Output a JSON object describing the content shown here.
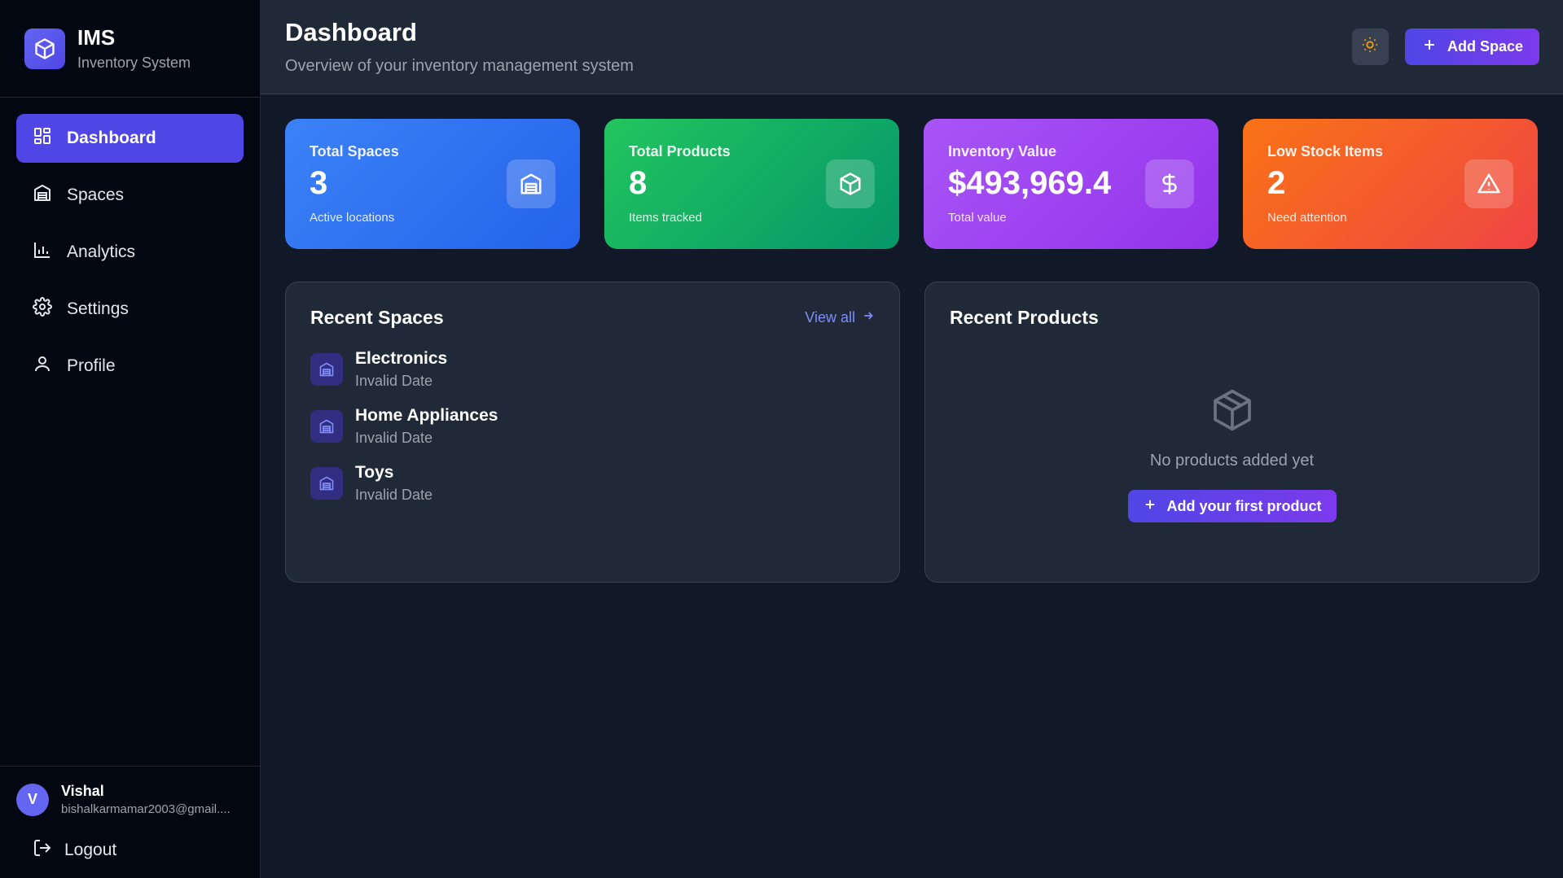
{
  "brand": {
    "title": "IMS",
    "subtitle": "Inventory System"
  },
  "nav": [
    {
      "label": "Dashboard",
      "icon": "dashboard-icon",
      "active": true
    },
    {
      "label": "Spaces",
      "icon": "warehouse-icon"
    },
    {
      "label": "Analytics",
      "icon": "bar-chart-icon"
    },
    {
      "label": "Settings",
      "icon": "gear-icon"
    },
    {
      "label": "Profile",
      "icon": "user-icon"
    }
  ],
  "user": {
    "initial": "V",
    "name": "Vishal",
    "email": "bishalkarmamar2003@gmail...."
  },
  "logout_label": "Logout",
  "header": {
    "title": "Dashboard",
    "subtitle": "Overview of your inventory management system",
    "add_space_label": "Add Space"
  },
  "stats": [
    {
      "label": "Total Spaces",
      "value": "3",
      "note": "Active locations",
      "color": "#3b82f6",
      "icon": "warehouse-icon"
    },
    {
      "label": "Total Products",
      "value": "8",
      "note": "Items tracked",
      "color": "#22c55e",
      "icon": "box-icon"
    },
    {
      "label": "Inventory Value",
      "value": "$493,969.4",
      "note": "Total value",
      "color": "#a855f7",
      "icon": "dollar-icon"
    },
    {
      "label": "Low Stock Items",
      "value": "2",
      "note": "Need attention",
      "color": "#f97316",
      "icon": "warning-icon"
    }
  ],
  "recent_spaces": {
    "title": "Recent Spaces",
    "view_all": "View all",
    "items": [
      {
        "name": "Electronics",
        "date": "Invalid Date"
      },
      {
        "name": "Home Appliances",
        "date": "Invalid Date"
      },
      {
        "name": "Toys",
        "date": "Invalid Date"
      }
    ]
  },
  "recent_products": {
    "title": "Recent Products",
    "empty_text": "No products added yet",
    "add_first_label": "Add your first product"
  },
  "colors": {
    "accent": "#4f46e5",
    "sidebar_bg": "#030712",
    "main_bg": "#111827",
    "card_bg": "#1f2937",
    "sun": "#f59e0b"
  }
}
